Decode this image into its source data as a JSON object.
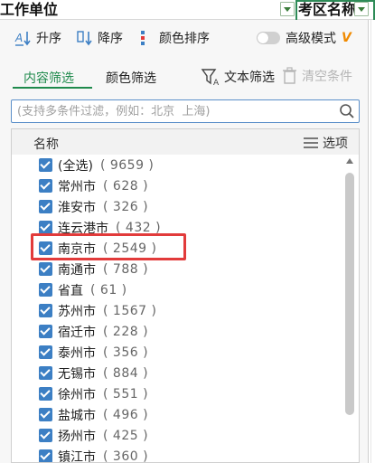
{
  "sheet": {
    "column_a_title": "工作单位",
    "column_b_title": "考区名称"
  },
  "toolbar": {
    "sort_asc": "升序",
    "sort_desc": "降序",
    "color_sort": "颜色排序",
    "advanced_mode": "高级模式",
    "advanced_mode_on": false,
    "vip_badge": "V"
  },
  "tabs": {
    "content_filter": "内容筛选",
    "color_filter": "颜色筛选",
    "text_filter": "文本筛选",
    "clear_conditions": "清空条件"
  },
  "search": {
    "placeholder": "(支持多条件过滤，例如：北京  上海)",
    "value": ""
  },
  "list": {
    "header_name": "名称",
    "header_options": "选项",
    "items": [
      {
        "label": "(全选)",
        "count": "( 9659 )",
        "checked": true
      },
      {
        "label": "常州市",
        "count": "( 628 )",
        "checked": true
      },
      {
        "label": "淮安市",
        "count": "( 326 )",
        "checked": true
      },
      {
        "label": "连云港市",
        "count": "( 432 )",
        "checked": true
      },
      {
        "label": "南京市",
        "count": "( 2549 )",
        "checked": true
      },
      {
        "label": "南通市",
        "count": "( 788 )",
        "checked": true
      },
      {
        "label": "省直",
        "count": "( 61 )",
        "checked": true
      },
      {
        "label": "苏州市",
        "count": "( 1567 )",
        "checked": true
      },
      {
        "label": "宿迁市",
        "count": "( 228 )",
        "checked": true
      },
      {
        "label": "泰州市",
        "count": "( 356 )",
        "checked": true
      },
      {
        "label": "无锡市",
        "count": "( 884 )",
        "checked": true
      },
      {
        "label": "徐州市",
        "count": "( 551 )",
        "checked": true
      },
      {
        "label": "盐城市",
        "count": "( 496 )",
        "checked": true
      },
      {
        "label": "扬州市",
        "count": "( 425 )",
        "checked": true
      },
      {
        "label": "镇江市",
        "count": "( 360 )",
        "checked": true
      }
    ]
  },
  "colors": {
    "accent_green": "#1f8a4c",
    "checkbox_blue": "#3c7fc4",
    "highlight_red": "#e23b3b",
    "vip_orange": "#f08a00"
  }
}
